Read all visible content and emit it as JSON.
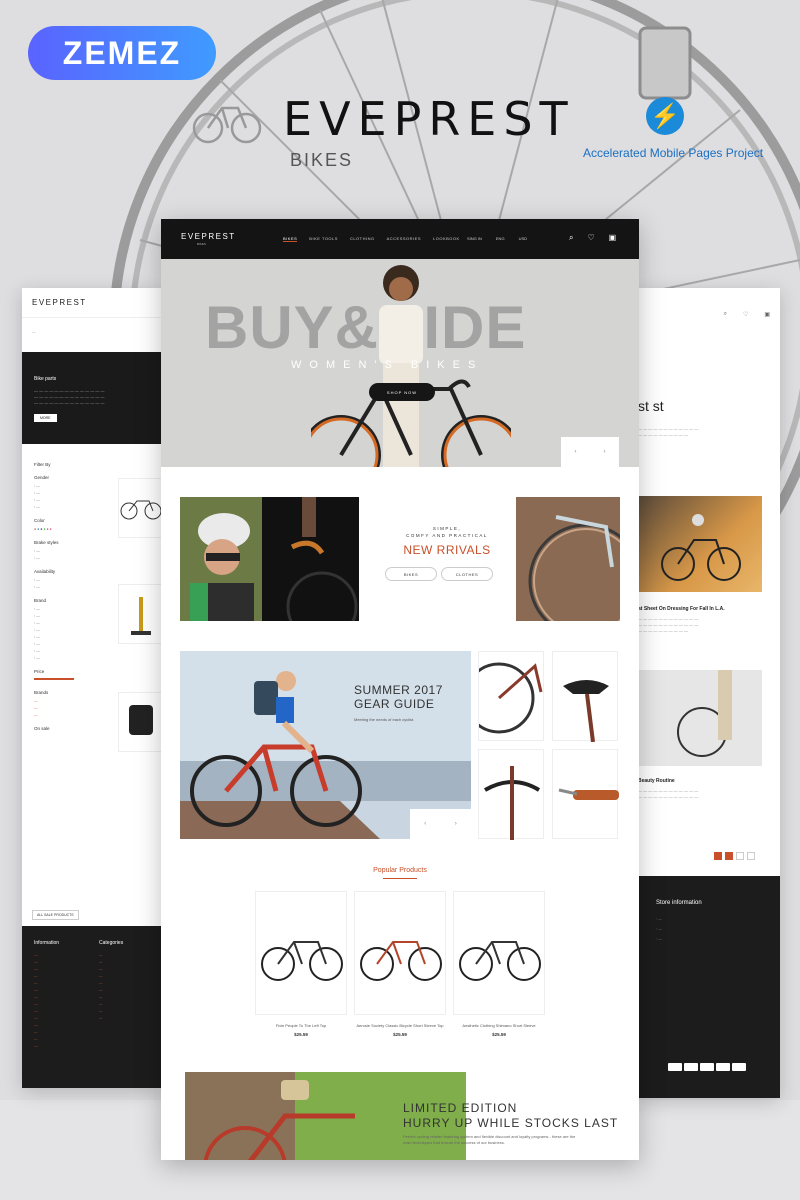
{
  "badge": {
    "label": "ZEMEZ"
  },
  "brand": {
    "title": "EVEPREST",
    "subtitle": "BIKES"
  },
  "amp": {
    "icon": "lightning-icon",
    "label": "Accelerated Mobile Pages Project"
  },
  "center": {
    "nav": {
      "logo": "EVEPREST",
      "logo_sub": "BIKES",
      "menu": [
        "BIKES",
        "BIKE TOOLS",
        "CLOTHING",
        "ACCESSORIES",
        "LOOKBOOK"
      ],
      "sign_in": "SING IN",
      "lang": "ENG",
      "currency": "USD"
    },
    "hero": {
      "headline": "BUY&RIDE",
      "subtitle": "WOMEN'S BIKES",
      "button": "SHOP NOW"
    },
    "arrivals": {
      "kicker_1": "SIMPLE,",
      "kicker_2": "COMFY AND PRACTICAL",
      "title": "NEW RRIVALS",
      "button_1": "BIKES",
      "button_2": "CLOTHES"
    },
    "gear": {
      "title_1": "SUMMER 2017",
      "title_2": "GEAR GUIDE",
      "desc": "Meeting the needs of each cyclist."
    },
    "popular": {
      "title": "Popular Products",
      "products": [
        {
          "name": "Fixie People To The Left Top",
          "price": "$25.59"
        },
        {
          "name": "Aerosie Society Classic Bicycle Short Sleeve Top",
          "price": "$25.59"
        },
        {
          "name": "Aesthetic Clothing Shimano Short Sleeve",
          "price": "$25.59"
        }
      ]
    },
    "limited": {
      "title_1": "LIMITED EDITION",
      "title_2": "HURRY UP WHILE STOCKS LAST",
      "desc": "Perfect cycling retailer featuring system and flexible discount and loyalty programs - these are the main techniques that ensure the success of our business."
    }
  },
  "left": {
    "logo": "EVEPREST",
    "dark_title": "Bike parts",
    "dark_button": "MORE",
    "filter_title": "Filter By",
    "filter_groups": [
      "Gender",
      "Color",
      "Brake styles",
      "Availability",
      "Brand",
      "Price",
      "Brands",
      "On sale"
    ],
    "all_sale": "ALL SALE PRODUCTS",
    "footer_col_1": "Information",
    "footer_col_2": "Categories"
  },
  "right": {
    "title": "st st",
    "post_1": "at Sheet On Dressing For Fall In L.A.",
    "post_2": "Beauty Routine",
    "footer_title": "Store information"
  }
}
